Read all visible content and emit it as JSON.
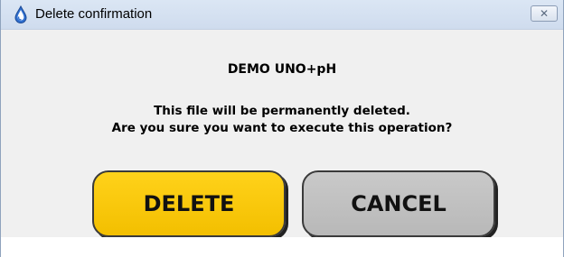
{
  "window": {
    "title": "Delete confirmation",
    "app_icon": "drop-icon",
    "close_icon": "close-icon",
    "close_glyph": "✕"
  },
  "dialog": {
    "heading": "DEMO UNO+pH",
    "message_line1": "This file will be permanently deleted.",
    "message_line2": "Are you sure you want to execute this operation?"
  },
  "buttons": {
    "delete_label": "DELETE",
    "cancel_label": "CANCEL"
  },
  "colors": {
    "delete_button": "#f7c600",
    "cancel_button": "#c0c0c0",
    "titlebar": "#d6e2f2"
  }
}
